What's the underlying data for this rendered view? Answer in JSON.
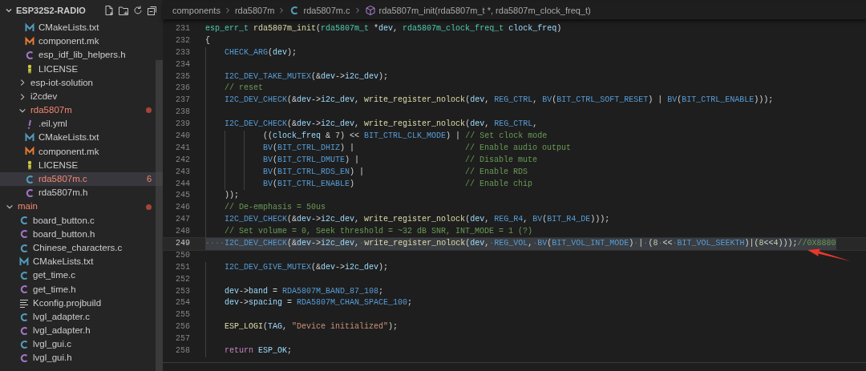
{
  "sidebar": {
    "title": "ESP32S2-RADIO",
    "tree": [
      {
        "children": [
          {
            "children": [
              {
                "label": "CMakeLists.txt",
                "kind": "cmake",
                "selected": false,
                "error": false
              },
              {
                "label": "component.mk",
                "kind": "make",
                "selected": false,
                "error": false
              },
              {
                "label": "esp_idf_lib_helpers.h",
                "kind": "h",
                "selected": false,
                "error": false
              },
              {
                "label": "LICENSE",
                "kind": "license",
                "selected": false,
                "error": false
              }
            ]
          },
          {
            "label": "esp-iot-solution",
            "kind": "folder",
            "expanded": false,
            "selected": false,
            "error": false
          },
          {
            "label": "i2cdev",
            "kind": "folder",
            "expanded": false,
            "selected": false,
            "error": false
          },
          {
            "label": "rda5807m",
            "kind": "folder",
            "expanded": true,
            "selected": false,
            "error": true,
            "children": [
              {
                "label": ".eil.yml",
                "kind": "yaml",
                "selected": false,
                "error": false
              },
              {
                "label": "CMakeLists.txt",
                "kind": "cmake",
                "selected": false,
                "error": false
              },
              {
                "label": "component.mk",
                "kind": "make",
                "selected": false,
                "error": false
              },
              {
                "label": "LICENSE",
                "kind": "license",
                "selected": false,
                "error": false
              },
              {
                "label": "rda5807m.c",
                "kind": "c",
                "selected": true,
                "error": true,
                "badge": "6"
              },
              {
                "label": "rda5807m.h",
                "kind": "h",
                "selected": false,
                "error": false
              }
            ]
          }
        ]
      },
      {
        "label": "main",
        "kind": "folder",
        "expanded": true,
        "selected": false,
        "error": true,
        "children": [
          {
            "label": "board_button.c",
            "kind": "c",
            "selected": false,
            "error": false
          },
          {
            "label": "board_button.h",
            "kind": "h",
            "selected": false,
            "error": false
          },
          {
            "label": "Chinese_characters.c",
            "kind": "c",
            "selected": false,
            "error": false
          },
          {
            "label": "CMakeLists.txt",
            "kind": "cmake",
            "selected": false,
            "error": false
          },
          {
            "label": "get_time.c",
            "kind": "c",
            "selected": false,
            "error": false
          },
          {
            "label": "get_time.h",
            "kind": "h",
            "selected": false,
            "error": false
          },
          {
            "label": "Kconfig.projbuild",
            "kind": "lines",
            "selected": false,
            "error": false
          },
          {
            "label": "lvgl_adapter.c",
            "kind": "c",
            "selected": false,
            "error": false
          },
          {
            "label": "lvgl_adapter.h",
            "kind": "h",
            "selected": false,
            "error": false
          },
          {
            "label": "lvgl_gui.c",
            "kind": "c",
            "selected": false,
            "error": false
          },
          {
            "label": "lvgl_gui.h",
            "kind": "h",
            "selected": false,
            "error": false
          }
        ]
      }
    ]
  },
  "breadcrumb": [
    {
      "label": "components",
      "kind": "folder"
    },
    {
      "label": "rda5807m",
      "kind": "folder"
    },
    {
      "label": "rda5807m.c",
      "kind": "c"
    },
    {
      "label": "rda5807m_init(rda5807m_t *, rda5807m_clock_freq_t)",
      "kind": "function"
    }
  ],
  "editor": {
    "lines": [
      {
        "number": "231",
        "highlighted": false,
        "tokens": [
          {
            "kind": "type",
            "text": "esp_err_t"
          },
          {
            "kind": "function",
            "text": " rda5807m_init"
          },
          {
            "kind": "plain",
            "text": "("
          },
          {
            "kind": "type",
            "text": "rda5807m_t"
          },
          {
            "kind": "plain",
            "text": " *"
          },
          {
            "kind": "variable",
            "text": "dev"
          },
          {
            "kind": "plain",
            "text": ", "
          },
          {
            "kind": "type",
            "text": "rda5807m_clock_freq_t"
          },
          {
            "kind": "variable",
            "text": " clock_freq"
          },
          {
            "kind": "plain",
            "text": ")"
          }
        ]
      },
      {
        "number": "232",
        "highlighted": false,
        "tokens": [
          {
            "kind": "plain",
            "text": "{"
          }
        ]
      },
      {
        "number": "233",
        "highlighted": false,
        "tokens": [
          {
            "kind": "macro",
            "text": "    CHECK_ARG"
          },
          {
            "kind": "plain",
            "text": "("
          },
          {
            "kind": "variable",
            "text": "dev"
          },
          {
            "kind": "plain",
            "text": ");"
          }
        ]
      },
      {
        "number": "234",
        "highlighted": false
      },
      {
        "number": "235",
        "highlighted": false,
        "tokens": [
          {
            "kind": "macro",
            "text": "    I2C_DEV_TAKE_MUTEX"
          },
          {
            "kind": "plain",
            "text": "(&"
          },
          {
            "kind": "variable",
            "text": "dev"
          },
          {
            "kind": "plain",
            "text": "->"
          },
          {
            "kind": "variable",
            "text": "i2c_dev"
          },
          {
            "kind": "plain",
            "text": ");"
          }
        ]
      },
      {
        "number": "236",
        "highlighted": false,
        "tokens": [
          {
            "kind": "comment",
            "text": "    // reset"
          }
        ]
      },
      {
        "number": "237",
        "highlighted": false,
        "tokens": [
          {
            "kind": "macro",
            "text": "    I2C_DEV_CHECK"
          },
          {
            "kind": "plain",
            "text": "(&"
          },
          {
            "kind": "variable",
            "text": "dev"
          },
          {
            "kind": "plain",
            "text": "->"
          },
          {
            "kind": "variable",
            "text": "i2c_dev"
          },
          {
            "kind": "plain",
            "text": ", "
          },
          {
            "kind": "function",
            "text": "write_register_nolock"
          },
          {
            "kind": "plain",
            "text": "("
          },
          {
            "kind": "variable",
            "text": "dev"
          },
          {
            "kind": "plain",
            "text": ", "
          },
          {
            "kind": "macro",
            "text": "REG_CTRL"
          },
          {
            "kind": "plain",
            "text": ", "
          },
          {
            "kind": "macro",
            "text": "BV"
          },
          {
            "kind": "plain",
            "text": "("
          },
          {
            "kind": "macro",
            "text": "BIT_CTRL_SOFT_RESET"
          },
          {
            "kind": "plain",
            "text": ") | "
          },
          {
            "kind": "macro",
            "text": "BV"
          },
          {
            "kind": "plain",
            "text": "("
          },
          {
            "kind": "macro",
            "text": "BIT_CTRL_ENABLE"
          },
          {
            "kind": "plain",
            "text": ")));"
          }
        ]
      },
      {
        "number": "238",
        "highlighted": false
      },
      {
        "number": "239",
        "highlighted": false,
        "tokens": [
          {
            "kind": "macro",
            "text": "    I2C_DEV_CHECK"
          },
          {
            "kind": "plain",
            "text": "(&"
          },
          {
            "kind": "variable",
            "text": "dev"
          },
          {
            "kind": "plain",
            "text": "->"
          },
          {
            "kind": "variable",
            "text": "i2c_dev"
          },
          {
            "kind": "plain",
            "text": ", "
          },
          {
            "kind": "function",
            "text": "write_register_nolock"
          },
          {
            "kind": "plain",
            "text": "("
          },
          {
            "kind": "variable",
            "text": "dev"
          },
          {
            "kind": "plain",
            "text": ", "
          },
          {
            "kind": "macro",
            "text": "REG_CTRL"
          },
          {
            "kind": "plain",
            "text": ","
          }
        ]
      },
      {
        "number": "240",
        "highlighted": false,
        "tokens": [
          {
            "kind": "plain",
            "text": "            (("
          },
          {
            "kind": "variable",
            "text": "clock_freq"
          },
          {
            "kind": "plain",
            "text": " & "
          },
          {
            "kind": "number",
            "text": "7"
          },
          {
            "kind": "plain",
            "text": ") << "
          },
          {
            "kind": "macro",
            "text": "BIT_CTRL_CLK_MODE"
          },
          {
            "kind": "plain",
            "text": ") | "
          },
          {
            "kind": "comment",
            "text": "// Set clock mode"
          }
        ]
      },
      {
        "number": "241",
        "highlighted": false,
        "tokens": [
          {
            "kind": "macro",
            "text": "            BV"
          },
          {
            "kind": "plain",
            "text": "("
          },
          {
            "kind": "macro",
            "text": "BIT_CTRL_DHIZ"
          },
          {
            "kind": "plain",
            "text": ") |                       "
          },
          {
            "kind": "comment",
            "text": "// Enable audio output"
          }
        ]
      },
      {
        "number": "242",
        "highlighted": false,
        "tokens": [
          {
            "kind": "macro",
            "text": "            BV"
          },
          {
            "kind": "plain",
            "text": "("
          },
          {
            "kind": "macro",
            "text": "BIT_CTRL_DMUTE"
          },
          {
            "kind": "plain",
            "text": ") |                      "
          },
          {
            "kind": "comment",
            "text": "// Disable mute"
          }
        ]
      },
      {
        "number": "243",
        "highlighted": false,
        "tokens": [
          {
            "kind": "macro",
            "text": "            BV"
          },
          {
            "kind": "plain",
            "text": "("
          },
          {
            "kind": "macro",
            "text": "BIT_CTRL_RDS_EN"
          },
          {
            "kind": "plain",
            "text": ") |                     "
          },
          {
            "kind": "comment",
            "text": "// Enable RDS"
          }
        ]
      },
      {
        "number": "244",
        "highlighted": false,
        "tokens": [
          {
            "kind": "macro",
            "text": "            BV"
          },
          {
            "kind": "plain",
            "text": "("
          },
          {
            "kind": "macro",
            "text": "BIT_CTRL_ENABLE"
          },
          {
            "kind": "plain",
            "text": ")                       "
          },
          {
            "kind": "comment",
            "text": "// Enable chip"
          }
        ]
      },
      {
        "number": "245",
        "highlighted": false,
        "tokens": [
          {
            "kind": "plain",
            "text": "    ));"
          }
        ]
      },
      {
        "number": "246",
        "highlighted": false,
        "tokens": [
          {
            "kind": "comment",
            "text": "    // De-emphasis = 50us"
          }
        ]
      },
      {
        "number": "247",
        "highlighted": false,
        "tokens": [
          {
            "kind": "macro",
            "text": "    I2C_DEV_CHECK"
          },
          {
            "kind": "plain",
            "text": "(&"
          },
          {
            "kind": "variable",
            "text": "dev"
          },
          {
            "kind": "plain",
            "text": "->"
          },
          {
            "kind": "variable",
            "text": "i2c_dev"
          },
          {
            "kind": "plain",
            "text": ", "
          },
          {
            "kind": "function",
            "text": "write_register_nolock"
          },
          {
            "kind": "plain",
            "text": "("
          },
          {
            "kind": "variable",
            "text": "dev"
          },
          {
            "kind": "plain",
            "text": ", "
          },
          {
            "kind": "macro",
            "text": "REG_R4"
          },
          {
            "kind": "plain",
            "text": ", "
          },
          {
            "kind": "macro",
            "text": "BV"
          },
          {
            "kind": "plain",
            "text": "("
          },
          {
            "kind": "macro",
            "text": "BIT_R4_DE"
          },
          {
            "kind": "plain",
            "text": ")));"
          }
        ]
      },
      {
        "number": "248",
        "highlighted": false,
        "tokens": [
          {
            "kind": "comment",
            "text": "    // Set volume = 0, Seek threshold = ~32 dB SNR, INT_MODE = 1 (?)"
          }
        ]
      },
      {
        "number": "249",
        "highlighted": true,
        "tokens": [
          {
            "kind": "whitespace",
            "text": "····"
          },
          {
            "kind": "macro",
            "text": "I2C_DEV_CHECK"
          },
          {
            "kind": "plain",
            "text": "(&"
          },
          {
            "kind": "variable",
            "text": "dev"
          },
          {
            "kind": "plain",
            "text": "->"
          },
          {
            "kind": "variable",
            "text": "i2c_dev"
          },
          {
            "kind": "plain",
            "text": ","
          },
          {
            "kind": "whitespace",
            "text": "·"
          },
          {
            "kind": "function",
            "text": "write_register_nolock"
          },
          {
            "kind": "plain",
            "text": "("
          },
          {
            "kind": "variable",
            "text": "dev"
          },
          {
            "kind": "plain",
            "text": ","
          },
          {
            "kind": "whitespace",
            "text": "·"
          },
          {
            "kind": "macro",
            "text": "REG_VOL"
          },
          {
            "kind": "plain",
            "text": ","
          },
          {
            "kind": "whitespace",
            "text": "·"
          },
          {
            "kind": "macro",
            "text": "BV"
          },
          {
            "kind": "plain",
            "text": "("
          },
          {
            "kind": "macro",
            "text": "BIT_VOL_INT_MODE"
          },
          {
            "kind": "plain",
            "text": ")"
          },
          {
            "kind": "whitespace",
            "text": "·"
          },
          {
            "kind": "plain",
            "text": "|"
          },
          {
            "kind": "whitespace",
            "text": "·"
          },
          {
            "kind": "plain",
            "text": "("
          },
          {
            "kind": "number",
            "text": "8"
          },
          {
            "kind": "whitespace",
            "text": "·"
          },
          {
            "kind": "plain",
            "text": "<<"
          },
          {
            "kind": "whitespace",
            "text": "·"
          },
          {
            "kind": "macro",
            "text": "BIT_VOL_SEEKTH"
          },
          {
            "kind": "plain",
            "text": ")|("
          },
          {
            "kind": "number",
            "text": "8"
          },
          {
            "kind": "plain",
            "text": "<<"
          },
          {
            "kind": "number",
            "text": "4"
          },
          {
            "kind": "plain",
            "text": ")));"
          },
          {
            "kind": "comment",
            "text": "//0X8880"
          }
        ]
      },
      {
        "number": "250",
        "highlighted": false
      },
      {
        "number": "251",
        "highlighted": false,
        "tokens": [
          {
            "kind": "macro",
            "text": "    I2C_DEV_GIVE_MUTEX"
          },
          {
            "kind": "plain",
            "text": "(&"
          },
          {
            "kind": "variable",
            "text": "dev"
          },
          {
            "kind": "plain",
            "text": "->"
          },
          {
            "kind": "variable",
            "text": "i2c_dev"
          },
          {
            "kind": "plain",
            "text": ");"
          }
        ]
      },
      {
        "number": "252",
        "highlighted": false
      },
      {
        "number": "253",
        "highlighted": false,
        "tokens": [
          {
            "kind": "variable",
            "text": "    dev"
          },
          {
            "kind": "plain",
            "text": "->"
          },
          {
            "kind": "variable",
            "text": "band"
          },
          {
            "kind": "plain",
            "text": " = "
          },
          {
            "kind": "macro",
            "text": "RDA5807M_BAND_87_108"
          },
          {
            "kind": "plain",
            "text": ";"
          }
        ]
      },
      {
        "number": "254",
        "highlighted": false,
        "tokens": [
          {
            "kind": "variable",
            "text": "    dev"
          },
          {
            "kind": "plain",
            "text": "->"
          },
          {
            "kind": "variable",
            "text": "spacing"
          },
          {
            "kind": "plain",
            "text": " = "
          },
          {
            "kind": "macro",
            "text": "RDA5807M_CHAN_SPACE_100"
          },
          {
            "kind": "plain",
            "text": ";"
          }
        ]
      },
      {
        "number": "255",
        "highlighted": false
      },
      {
        "number": "256",
        "highlighted": false,
        "tokens": [
          {
            "kind": "function",
            "text": "    ESP_LOGI"
          },
          {
            "kind": "plain",
            "text": "("
          },
          {
            "kind": "variable",
            "text": "TAG"
          },
          {
            "kind": "plain",
            "text": ", "
          },
          {
            "kind": "string",
            "text": "\"Device initialized\""
          },
          {
            "kind": "plain",
            "text": ");"
          }
        ]
      },
      {
        "number": "257",
        "highlighted": false
      },
      {
        "number": "258",
        "highlighted": false,
        "tokens": [
          {
            "kind": "keyword",
            "text": "    return"
          },
          {
            "kind": "variable",
            "text": " ESP_OK"
          },
          {
            "kind": "plain",
            "text": ";"
          }
        ]
      }
    ]
  }
}
